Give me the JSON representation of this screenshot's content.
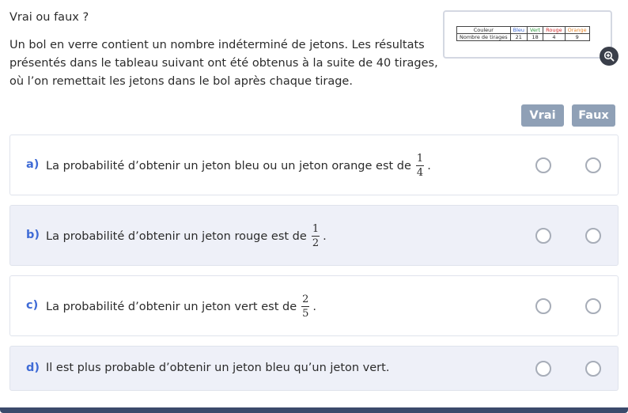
{
  "question": {
    "title": "Vrai ou faux ?",
    "stem": "Un bol en verre contient un nombre indéterminé de jetons. Les résultats présentés dans le tableau suivant ont été obtenus à la suite de 40 tirages, où l’on remettait les jetons dans le bol après chaque tirage."
  },
  "table": {
    "row1": {
      "label": "Couleur",
      "bleu": "Bleu",
      "vert": "Vert",
      "rouge": "Rouge",
      "orange": "Orange"
    },
    "row2": {
      "label": "Nombre de tirages",
      "bleu": "21",
      "vert": "18",
      "rouge": "4",
      "orange": "9"
    },
    "colors": {
      "bleu": "#3f6bd6",
      "vert": "#2e9e3e",
      "rouge": "#d62d2d",
      "orange": "#e8872b"
    }
  },
  "zoom": {
    "icon": "zoom-in-icon"
  },
  "buttons": {
    "vrai": "Vrai",
    "faux": "Faux"
  },
  "items": [
    {
      "letter": "a)",
      "text": "La probabilité d’obtenir un jeton bleu ou un jeton orange est de",
      "num": "1",
      "den": "4",
      "end": "."
    },
    {
      "letter": "b)",
      "text": "La probabilité d’obtenir un jeton rouge est de",
      "num": "1",
      "den": "2",
      "end": "."
    },
    {
      "letter": "c)",
      "text": "La probabilité d’obtenir un jeton vert est de",
      "num": "2",
      "den": "5",
      "end": "."
    },
    {
      "letter": "d)",
      "text": "Il est plus probable d’obtenir un jeton bleu qu’un jeton vert."
    }
  ],
  "colors": {
    "accent": "#3f6bd6",
    "button": "#8fa0b6",
    "alt_row": "#eef0f8"
  }
}
